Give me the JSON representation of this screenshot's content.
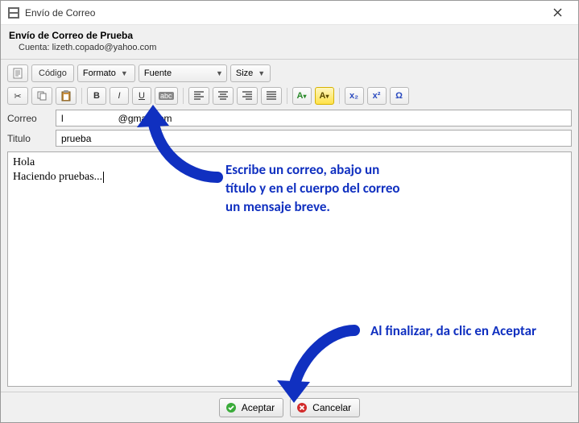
{
  "window": {
    "title": "Envío de Correo"
  },
  "subheader": {
    "title": "Envío de Correo de Prueba",
    "account_label": "Cuenta: lizeth.copado@yahoo.com"
  },
  "toolbar": {
    "source_button": "Código",
    "formato_label": "Formato",
    "fuente_label": "Fuente",
    "size_label": "Size",
    "buttons": {
      "bold": "B",
      "italic": "I",
      "underline": "U",
      "sub": "x₂",
      "sup": "x²",
      "omega": "Ω"
    }
  },
  "fields": {
    "correo_label": "Correo",
    "correo_value_visible_prefix": "l",
    "correo_value_visible_suffix": "@gmail.com",
    "titulo_label": "Titulo",
    "titulo_value": "prueba"
  },
  "body": {
    "line1": "Hola",
    "line2": "Haciendo pruebas..."
  },
  "footer": {
    "accept": "Aceptar",
    "cancel": "Cancelar"
  },
  "annotations": {
    "note1": "Escribe un correo, abajo un título  y en el cuerpo del correo un mensaje breve.",
    "note2": "Al finalizar, da clic en Aceptar"
  },
  "colors": {
    "annotation_blue": "#1030c0",
    "accept_green": "#3aab3a",
    "cancel_red": "#d22b2b"
  }
}
